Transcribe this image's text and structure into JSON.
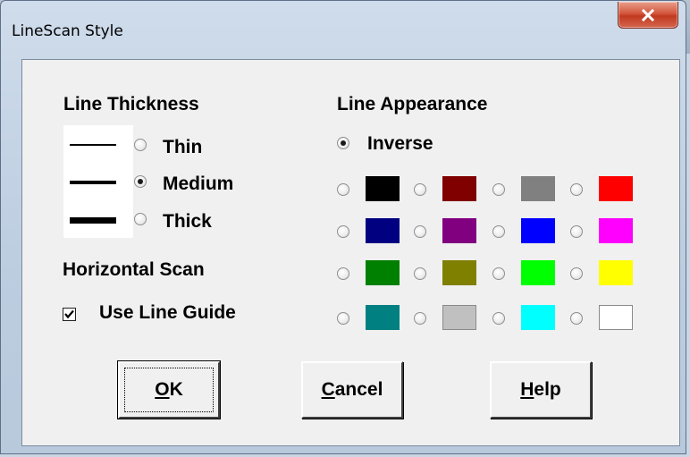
{
  "window": {
    "title": "LineScan Style",
    "close_icon": "close-icon"
  },
  "thickness": {
    "heading": "Line Thickness",
    "options": [
      {
        "label": "Thin",
        "selected": false
      },
      {
        "label": "Medium",
        "selected": true
      },
      {
        "label": "Thick",
        "selected": false
      }
    ]
  },
  "appearance": {
    "heading": "Line Appearance",
    "inverse_label": "Inverse",
    "inverse_selected": true,
    "colors": [
      [
        "#000000",
        "#800000",
        "#808080",
        "#ff0000"
      ],
      [
        "#000080",
        "#800080",
        "#0000ff",
        "#ff00ff"
      ],
      [
        "#008000",
        "#808000",
        "#00ff00",
        "#ffff00"
      ],
      [
        "#008080",
        "#c0c0c0",
        "#00ffff",
        "#ffffff"
      ]
    ]
  },
  "horizontal_scan": {
    "heading": "Horizontal Scan",
    "line_guide_label": "Use Line Guide",
    "line_guide_checked": true
  },
  "buttons": {
    "ok": {
      "mnemonic": "O",
      "rest": "K"
    },
    "cancel": {
      "mnemonic": "C",
      "rest": "ancel"
    },
    "help": {
      "mnemonic": "H",
      "rest": "elp"
    }
  }
}
